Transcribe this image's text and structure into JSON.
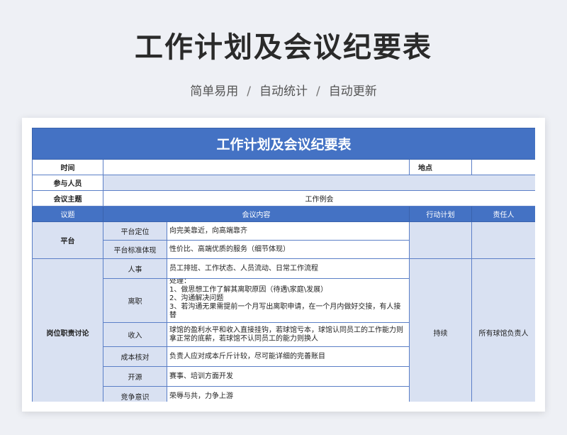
{
  "page": {
    "title": "工作计划及会议纪要表",
    "subtitle_parts": [
      "简单易用",
      "自动统计",
      "自动更新"
    ],
    "separator": "/"
  },
  "sheet": {
    "banner": "工作计划及会议纪要表",
    "time_label": "时间",
    "time_value": "",
    "place_label": "地点",
    "place_value": "",
    "participants_label": "参与人员",
    "participants_value": "",
    "theme_label": "会议主题",
    "theme_value": "工作例会",
    "headers": {
      "topic": "议题",
      "content": "会议内容",
      "action": "行动计划",
      "owner": "责任人"
    },
    "groups": [
      {
        "topic": "平台",
        "rows": [
          {
            "sub": "平台定位",
            "content": "向完美靠近，向高端靠齐"
          },
          {
            "sub": "平台标准体现",
            "content": "性价比、高端优质的服务（细节体现）"
          }
        ]
      },
      {
        "topic": "岗位职责讨论",
        "action": "持续",
        "owner": "所有球馆负责人",
        "rows": [
          {
            "sub": "人事",
            "content": "员工排班、工作状态、人员流动、日常工作流程"
          },
          {
            "sub": "离职",
            "content": [
              "处理：",
              "1、做思想工作了解其离职原因（待遇\\家庭\\发展）",
              "2、沟通解决问题",
              "3、若沟通无果需提前一个月写出离职申请，在一个月内做好交接，有人接替"
            ]
          },
          {
            "sub": "收入",
            "content": "球馆的盈利水平和收入直接挂钩，若球馆亏本，球馆认同员工的工作能力则拿正常的底薪，若球馆不认同员工的能力则换人"
          },
          {
            "sub": "成本核对",
            "content": "负责人应对成本斤斤计较，尽可能详细的完善账目"
          },
          {
            "sub": "开源",
            "content": "赛事、培训方面开发"
          },
          {
            "sub": "竞争意识",
            "content": "荣辱与共，力争上游"
          }
        ]
      }
    ]
  }
}
